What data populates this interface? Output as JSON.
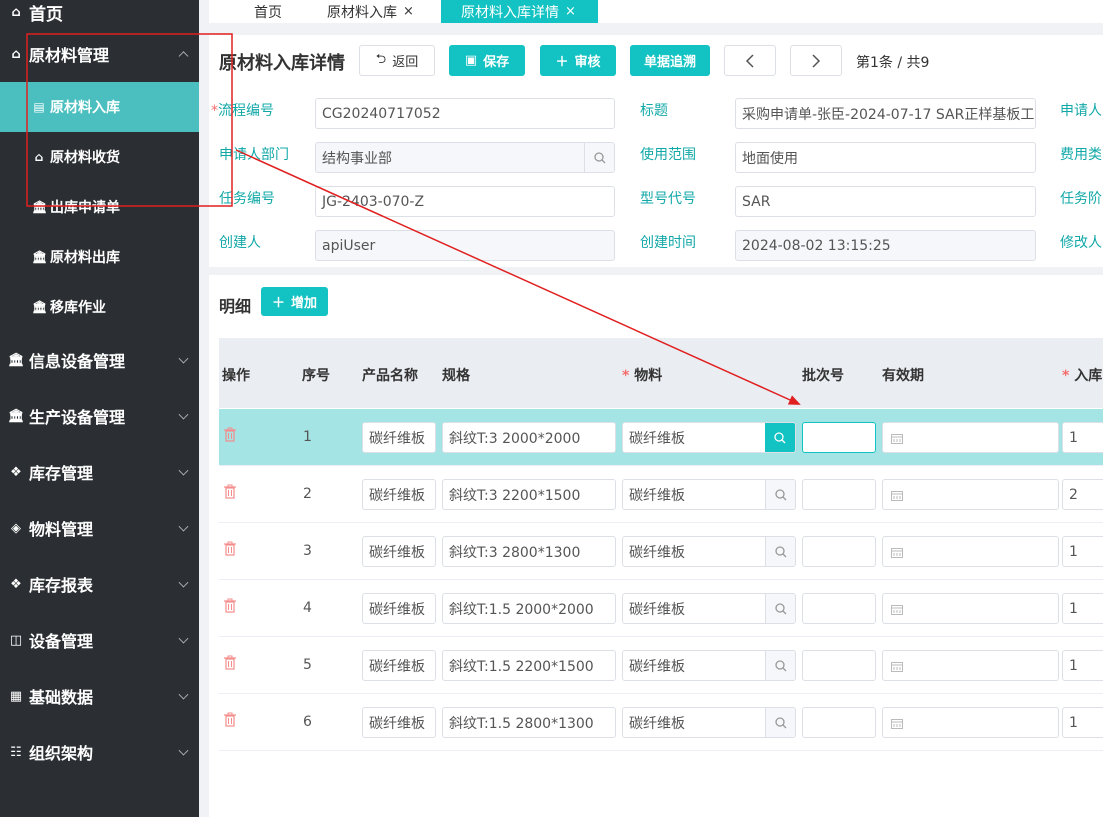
{
  "sidebar": {
    "home": "首页",
    "groups": [
      {
        "label": "原材料管理",
        "expanded": true,
        "icon": "home-outline-icon"
      },
      {
        "label": "信息设备管理",
        "icon": "bank-icon"
      },
      {
        "label": "生产设备管理",
        "icon": "bank-icon"
      },
      {
        "label": "库存管理",
        "icon": "cubes-icon"
      },
      {
        "label": "物料管理",
        "icon": "cube-icon"
      },
      {
        "label": "库存报表",
        "icon": "cubes-icon"
      },
      {
        "label": "设备管理",
        "icon": "box-icon"
      },
      {
        "label": "基础数据",
        "icon": "table-icon"
      },
      {
        "label": "组织架构",
        "icon": "org-icon"
      }
    ],
    "sub_items": [
      {
        "label": "原材料入库",
        "active": true,
        "icon": "doc-icon"
      },
      {
        "label": "原材料收货",
        "icon": "shop-icon"
      },
      {
        "label": "出库申请单",
        "icon": "bank-icon"
      },
      {
        "label": "原材料出库",
        "icon": "bank-icon"
      },
      {
        "label": "移库作业",
        "icon": "bank-icon"
      }
    ]
  },
  "tabs": [
    {
      "label": "首页"
    },
    {
      "label": "原材料入库",
      "close": "×"
    },
    {
      "label": "原材料入库详情",
      "close": "×",
      "active": true
    }
  ],
  "header": {
    "title": "原材料入库详情",
    "back_label": "返回",
    "save_label": "保存",
    "approve_label": "审核",
    "trace_label": "单据追溯",
    "pager": "第1条 / 共9"
  },
  "form": {
    "flow_no_label": "流程编号",
    "flow_no": "CG20240717052",
    "title_label": "标题",
    "title": "采购申请单-张臣-2024-07-17 SAR正样基板工",
    "applicant_label": "申请人",
    "dept_label": "申请人部门",
    "dept": "结构事业部",
    "scope_label": "使用范围",
    "scope": "地面使用",
    "fee_label": "费用类",
    "task_no_label": "任务编号",
    "task_no": "JG-2403-070-Z",
    "model_label": "型号代号",
    "model": "SAR",
    "task_stage_label": "任务阶",
    "creator_label": "创建人",
    "creator": "apiUser",
    "created_label": "创建时间",
    "created": "2024-08-02 13:15:25",
    "modifier_label": "修改人"
  },
  "detail": {
    "title": "明细",
    "add_label": "增加",
    "columns": {
      "op": "操作",
      "seq": "序号",
      "product": "产品名称",
      "spec": "规格",
      "material": "物料",
      "batch": "批次号",
      "expiry": "有效期",
      "qty": "入库"
    },
    "rows": [
      {
        "seq": "1",
        "product": "碳纤维板",
        "spec": "斜纹T:3 2000*2000",
        "material": "碳纤维板",
        "batch": "",
        "qty": "1"
      },
      {
        "seq": "2",
        "product": "碳纤维板",
        "spec": "斜纹T:3 2200*1500",
        "material": "碳纤维板",
        "batch": "",
        "qty": "2"
      },
      {
        "seq": "3",
        "product": "碳纤维板",
        "spec": "斜纹T:3 2800*1300",
        "material": "碳纤维板",
        "batch": "",
        "qty": "1"
      },
      {
        "seq": "4",
        "product": "碳纤维板",
        "spec": "斜纹T:1.5 2000*2000",
        "material": "碳纤维板",
        "batch": "",
        "qty": "1"
      },
      {
        "seq": "5",
        "product": "碳纤维板",
        "spec": "斜纹T:1.5 2200*1500",
        "material": "碳纤维板",
        "batch": "",
        "qty": "1"
      },
      {
        "seq": "6",
        "product": "碳纤维板",
        "spec": "斜纹T:1.5 2800*1300",
        "material": "碳纤维板",
        "batch": "",
        "qty": "1"
      }
    ]
  },
  "colors": {
    "accent": "#13c2c2",
    "sidebar_bg": "#2b2f33",
    "sidebar_active": "#4bbfbf",
    "label_teal": "#13a8a8",
    "required": "#f56c6c",
    "annotation_red": "#e02020",
    "row_highlight": "#a4e4e4"
  }
}
